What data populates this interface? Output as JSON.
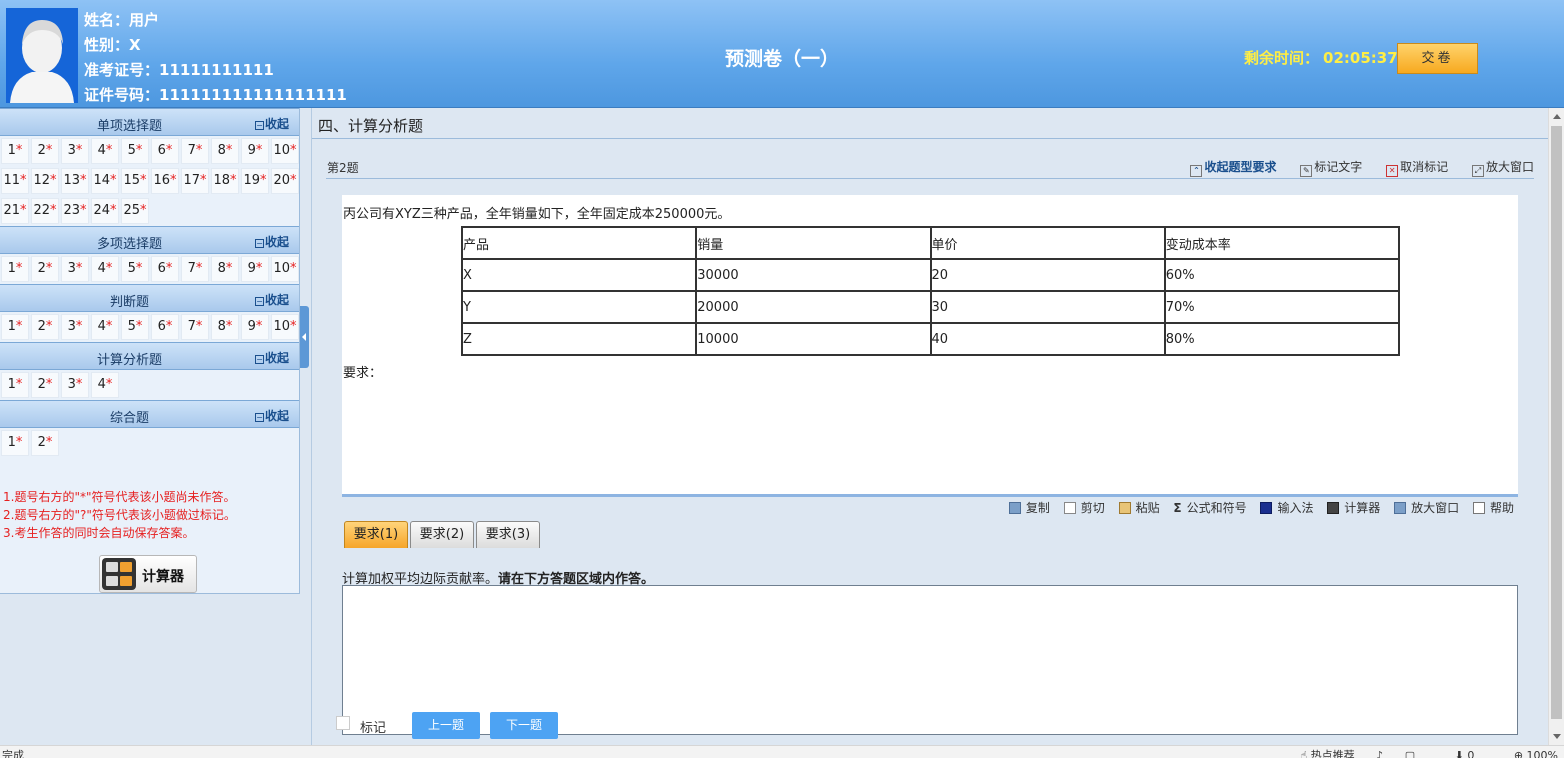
{
  "header": {
    "name_line": "姓名：用户",
    "gender_line": "性别：X",
    "ticket_line": "准考证号：11111111111",
    "id_line": "证件号码：111111111111111111",
    "exam_title": "预测卷（一）",
    "timer_label": "剩余时间：",
    "timer_value": "02:05:37",
    "submit_label": "交卷"
  },
  "sidebar": {
    "sections": [
      {
        "title": "单项选择题",
        "toggle": "收起",
        "count": 25
      },
      {
        "title": "多项选择题",
        "toggle": "收起",
        "count": 10
      },
      {
        "title": "判断题",
        "toggle": "收起",
        "count": 10
      },
      {
        "title": "计算分析题",
        "toggle": "收起",
        "count": 4
      },
      {
        "title": "综合题",
        "toggle": "收起",
        "count": 2
      }
    ],
    "unanswered_mark": "*",
    "notes": [
      "1.题号右方的\"*\"符号代表该小题尚未作答。",
      "2.题号右方的\"?\"符号代表该小题做过标记。",
      "3.考生作答的同时会自动保存答案。"
    ],
    "calculator_label": "计算器"
  },
  "main": {
    "section_title": "四、计算分析题",
    "question_number": "第2题",
    "tools": {
      "collapse": "收起题型要求",
      "mark_text": "标记文字",
      "unmark": "取消标记",
      "enlarge": "放大窗口"
    },
    "intro": "丙公司有XYZ三种产品，全年销量如下，全年固定成本250000元。",
    "table": {
      "headers": [
        "产品",
        "销量",
        "单价",
        "变动成本率"
      ],
      "rows": [
        [
          "X",
          "30000",
          "20",
          "60%"
        ],
        [
          "Y",
          "20000",
          "30",
          "70%"
        ],
        [
          "Z",
          "10000",
          "40",
          "80%"
        ]
      ]
    },
    "requirement_label": "要求：",
    "edit_tools": {
      "copy": "复制",
      "cut": "剪切",
      "paste": "粘贴",
      "formula": "公式和符号",
      "input_method": "输入法",
      "calculator": "计算器",
      "enlarge": "放大窗口",
      "help": "帮助"
    },
    "tabs": [
      "要求(1)",
      "要求(2)",
      "要求(3)"
    ],
    "active_tab": 0,
    "sub_prompt": "计算加权平均边际贡献率。",
    "sub_prompt_bold": "请在下方答题区域内作答。",
    "answer_value": "",
    "mark_label": "标记",
    "prev_label": "上一题",
    "next_label": "下一题"
  },
  "statusbar": {
    "left": "完成",
    "hot": "热点推荐",
    "count": "0",
    "zoom": "100%"
  }
}
